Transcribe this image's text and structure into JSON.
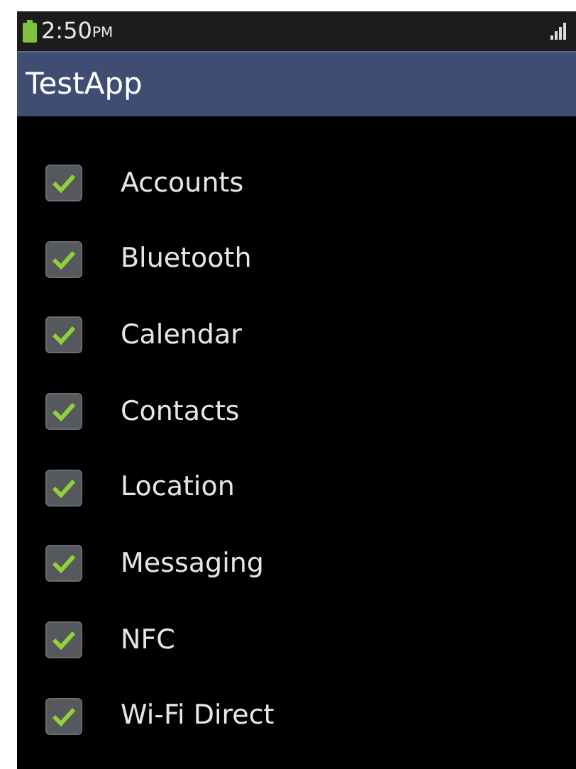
{
  "status_bar": {
    "time": "2:50",
    "period": "PM"
  },
  "app_bar": {
    "title": "TestApp"
  },
  "items": [
    {
      "label": "Accounts",
      "checked": true
    },
    {
      "label": "Bluetooth",
      "checked": true
    },
    {
      "label": "Calendar",
      "checked": true
    },
    {
      "label": "Contacts",
      "checked": true
    },
    {
      "label": "Location",
      "checked": true
    },
    {
      "label": "Messaging",
      "checked": true
    },
    {
      "label": "NFC",
      "checked": true
    },
    {
      "label": "Wi-Fi Direct",
      "checked": true
    }
  ]
}
